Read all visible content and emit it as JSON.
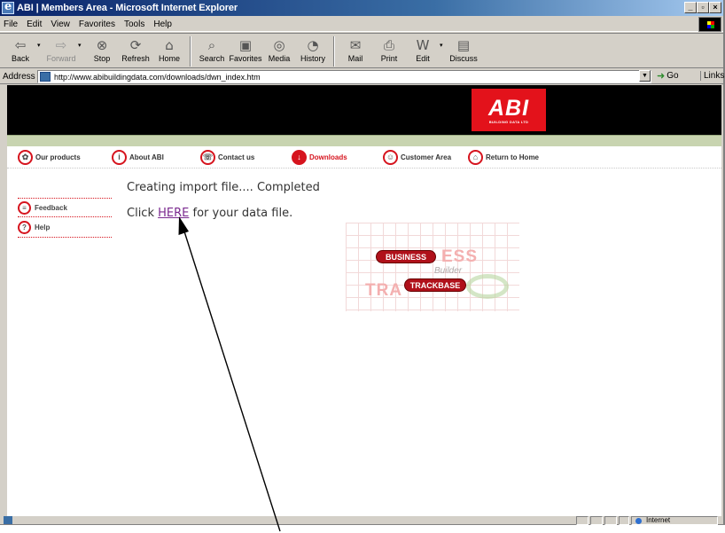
{
  "window": {
    "title": "ABI | Members Area - Microsoft Internet Explorer",
    "controls": [
      "_",
      "▫",
      "×"
    ]
  },
  "menu": [
    "File",
    "Edit",
    "View",
    "Favorites",
    "Tools",
    "Help"
  ],
  "toolbar": {
    "buttons": [
      {
        "label": "Back",
        "icon": "back-arrow-icon",
        "glyph": "⇦"
      },
      {
        "label": "Forward",
        "icon": "forward-arrow-icon",
        "glyph": "⇨"
      },
      {
        "label": "Stop",
        "icon": "stop-icon",
        "glyph": "⊗"
      },
      {
        "label": "Refresh",
        "icon": "refresh-icon",
        "glyph": "⟳"
      },
      {
        "label": "Home",
        "icon": "home-icon",
        "glyph": "⌂"
      },
      {
        "label": "Search",
        "icon": "search-icon",
        "glyph": "⌕"
      },
      {
        "label": "Favorites",
        "icon": "favorites-icon",
        "glyph": "▣"
      },
      {
        "label": "Media",
        "icon": "media-icon",
        "glyph": "◎"
      },
      {
        "label": "History",
        "icon": "history-icon",
        "glyph": "◔"
      },
      {
        "label": "Mail",
        "icon": "mail-icon",
        "glyph": "✉"
      },
      {
        "label": "Print",
        "icon": "print-icon",
        "glyph": "⎙"
      },
      {
        "label": "Edit",
        "icon": "edit-icon",
        "glyph": "W"
      },
      {
        "label": "Discuss",
        "icon": "discuss-icon",
        "glyph": "▤"
      }
    ]
  },
  "address": {
    "label": "Address",
    "url": "http://www.abibuildingdata.com/downloads/dwn_index.htm",
    "go_label": "Go",
    "links_label": "Links"
  },
  "site": {
    "logo_text": "ABI",
    "logo_sub": "BUILDING DATA LTD",
    "nav": [
      {
        "label": "Our products",
        "icon": "products-icon",
        "glyph": "✿"
      },
      {
        "label": "About ABI",
        "icon": "info-icon",
        "glyph": "i"
      },
      {
        "label": "Contact us",
        "icon": "contact-icon",
        "glyph": "☏"
      },
      {
        "label": "Downloads",
        "icon": "download-icon",
        "glyph": "↓"
      },
      {
        "label": "Customer Area",
        "icon": "customer-icon",
        "glyph": "☺"
      },
      {
        "label": "Return to Home",
        "icon": "home-icon",
        "glyph": "⌂"
      }
    ],
    "sidebar": [
      {
        "label": "Feedback",
        "icon": "feedback-icon",
        "glyph": "≡"
      },
      {
        "label": "Help",
        "icon": "help-icon",
        "glyph": "?"
      }
    ],
    "message_line1": "Creating import file.... Completed",
    "message_pre": "Click ",
    "message_link": "HERE",
    "message_post": " for your data file.",
    "bb_logo": {
      "business": "BUSINESS",
      "builder": "Builder",
      "trackbase": "TRACKBASE",
      "ess": "ESS",
      "tra": "TRA"
    }
  },
  "status": {
    "zone": "Internet"
  },
  "colors": {
    "brand_red": "#e3121b",
    "nav_band": "#c8d4b0",
    "link_visited": "#7b2a8f"
  }
}
